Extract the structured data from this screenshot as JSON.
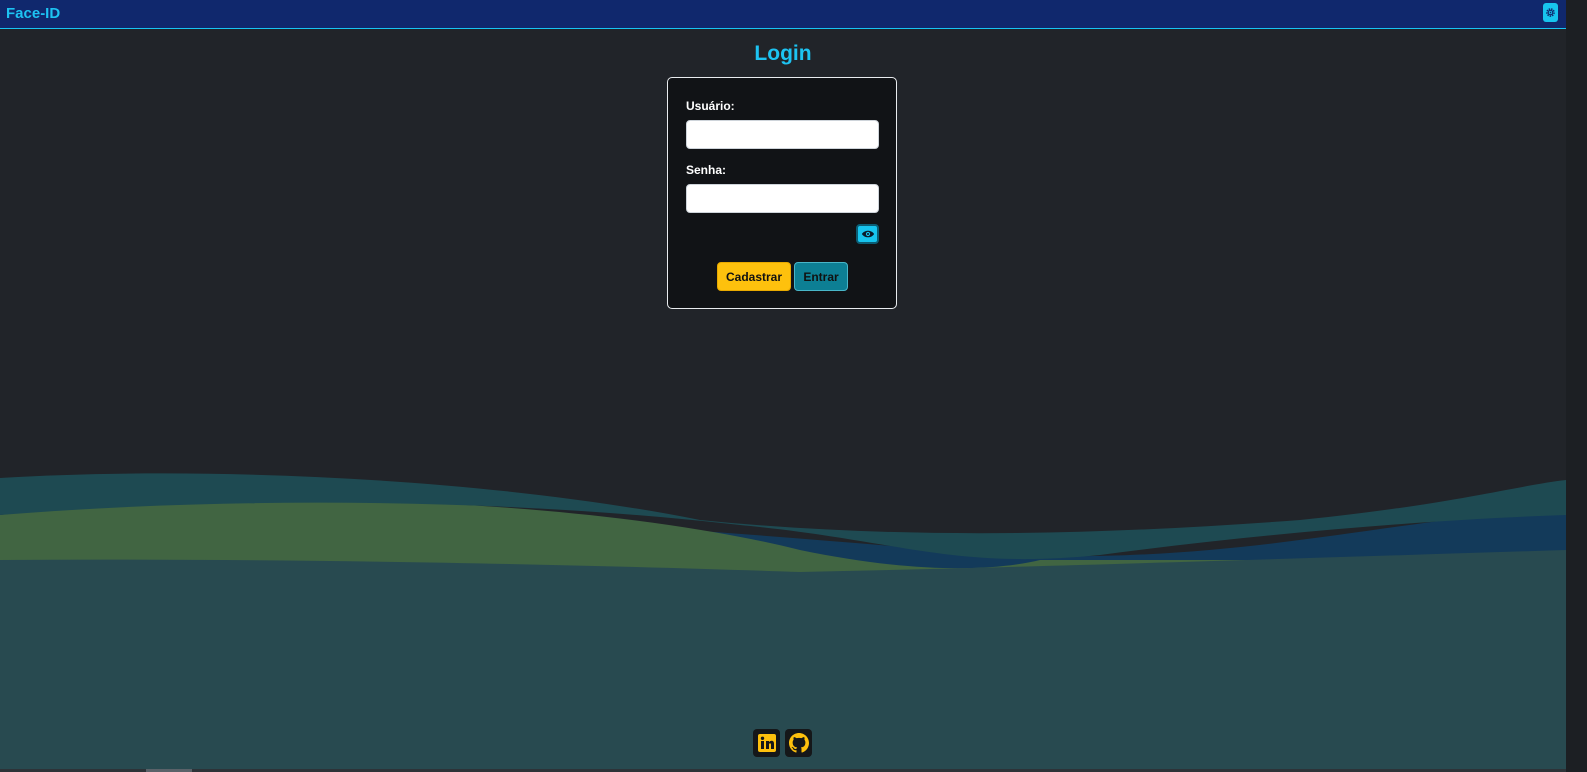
{
  "header": {
    "brand": "Face-ID",
    "settings_icon": "gear-icon"
  },
  "login": {
    "title": "Login",
    "username_label": "Usuário:",
    "username_value": "",
    "password_label": "Senha:",
    "password_value": "",
    "toggle_password_icon": "eye-icon",
    "register_button": "Cadastrar",
    "submit_button": "Entrar"
  },
  "footer": {
    "links": [
      {
        "icon": "linkedin-icon"
      },
      {
        "icon": "github-icon"
      }
    ]
  },
  "colors": {
    "background": "#212429",
    "topbar": "#10286d",
    "accent": "#1dc3f2",
    "register": "#fec10d",
    "submit": "#0d7f94",
    "wave_teal": "#28484e",
    "wave_green": "#416542",
    "wave_blue": "#133a5a"
  }
}
